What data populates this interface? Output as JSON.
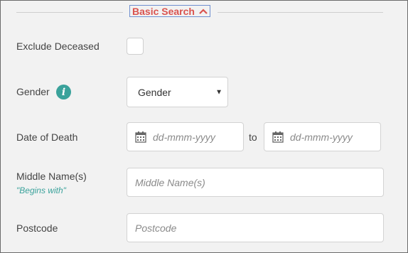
{
  "section_toggle": {
    "label": "Basic Search"
  },
  "fields": {
    "exclude_deceased": {
      "label": "Exclude Deceased"
    },
    "gender": {
      "label": "Gender",
      "selected": "Gender"
    },
    "date_of_death": {
      "label": "Date of Death",
      "from_placeholder": "dd-mmm-yyyy",
      "to_label": "to",
      "to_placeholder": "dd-mmm-yyyy"
    },
    "middle_names": {
      "label": "Middle Name(s)",
      "hint": "\"Begins with\"",
      "placeholder": "Middle Name(s)"
    },
    "postcode": {
      "label": "Postcode",
      "placeholder": "Postcode"
    }
  },
  "colors": {
    "accent_red": "#d9534f",
    "teal": "#3aa29b",
    "panel_bg": "#f2f2f2"
  },
  "icons": [
    "chevron-up-icon",
    "info-icon",
    "calendar-icon",
    "dropdown-caret-icon"
  ]
}
